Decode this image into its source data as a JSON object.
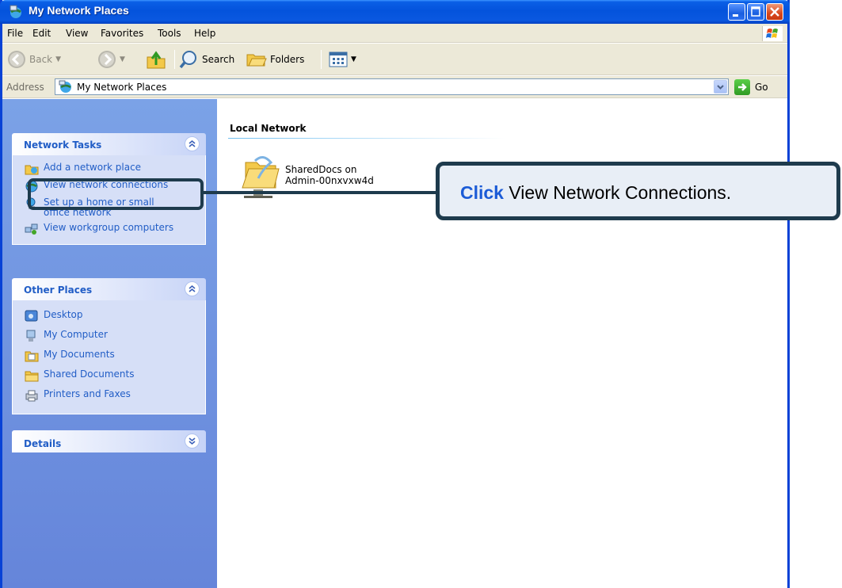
{
  "window": {
    "title": "My Network Places"
  },
  "menu": [
    "File",
    "Edit",
    "View",
    "Favorites",
    "Tools",
    "Help"
  ],
  "toolbar": {
    "back": "Back",
    "search": "Search",
    "folders": "Folders"
  },
  "address": {
    "label": "Address",
    "value": "My Network Places",
    "go": "Go"
  },
  "network_tasks": {
    "title": "Network Tasks",
    "items": [
      {
        "label": "Add a network place",
        "icon": "add-network-place-icon"
      },
      {
        "label": "View network connections",
        "icon": "network-connections-icon"
      },
      {
        "label": "Set up a home or small office network",
        "icon": "home-network-icon"
      },
      {
        "label": "View workgroup computers",
        "icon": "workgroup-icon"
      }
    ]
  },
  "other_places": {
    "title": "Other Places",
    "items": [
      {
        "label": "Desktop",
        "icon": "desktop-icon"
      },
      {
        "label": "My Computer",
        "icon": "my-computer-icon"
      },
      {
        "label": "My Documents",
        "icon": "my-documents-icon"
      },
      {
        "label": "Shared Documents",
        "icon": "folder-icon"
      },
      {
        "label": "Printers and Faxes",
        "icon": "printer-icon"
      }
    ]
  },
  "details": {
    "title": "Details"
  },
  "content": {
    "group_header": "Local Network",
    "share_line1": "SharedDocs on",
    "share_line2": "Admin-00nxvxw4d"
  },
  "callout": {
    "click": "Click",
    "rest": " View Network Connections."
  },
  "colors": {
    "title_bar": "#0453dc",
    "task_pane": "#7ba2e7",
    "task_link": "#215dc6",
    "callout_border": "#1e3b4d",
    "callout_click": "#1b5bd6"
  }
}
